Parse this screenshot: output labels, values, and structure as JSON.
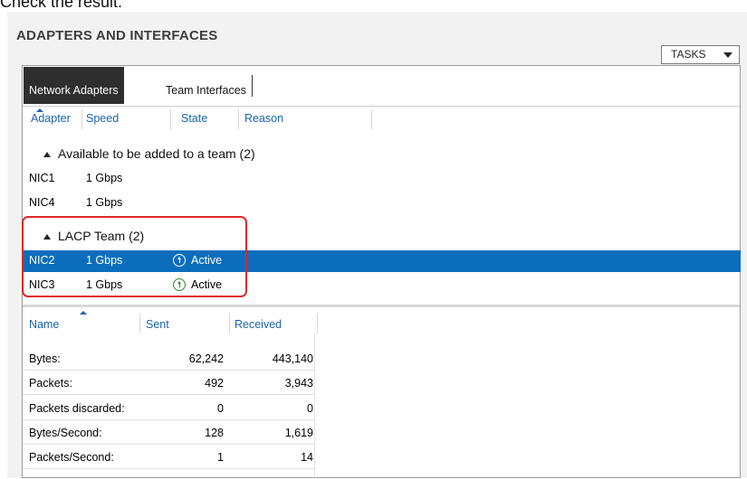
{
  "caption": "Check the result:",
  "section": {
    "title": "ADAPTERS AND INTERFACES",
    "tasks_label": "TASKS"
  },
  "tabs": [
    {
      "label": "Network Adapters",
      "active": true
    },
    {
      "label": "Team Interfaces",
      "active": false
    }
  ],
  "adapters": {
    "columns": [
      "Adapter",
      "Speed",
      "State",
      "Reason"
    ],
    "groups": [
      {
        "label": "Available to be added to a team (2)",
        "rows": [
          {
            "adapter": "NIC1",
            "speed": "1 Gbps",
            "state": "",
            "reason": ""
          },
          {
            "adapter": "NIC4",
            "speed": "1 Gbps",
            "state": "",
            "reason": ""
          }
        ]
      },
      {
        "label": "LACP Team (2)",
        "rows": [
          {
            "adapter": "NIC2",
            "speed": "1 Gbps",
            "state": "Active",
            "reason": "",
            "selected": true
          },
          {
            "adapter": "NIC3",
            "speed": "1 Gbps",
            "state": "Active",
            "reason": ""
          }
        ]
      }
    ]
  },
  "stats": {
    "columns": [
      "Name",
      "Sent",
      "Received"
    ],
    "rows": [
      {
        "name": "Bytes:",
        "sent": "62,242",
        "received": "443,140"
      },
      {
        "name": "Packets:",
        "sent": "492",
        "received": "3,943"
      },
      {
        "name": "Packets discarded:",
        "sent": "0",
        "received": "0"
      },
      {
        "name": "Bytes/Second:",
        "sent": "128",
        "received": "1,619"
      },
      {
        "name": "Packets/Second:",
        "sent": "1",
        "received": "14"
      }
    ]
  },
  "colors": {
    "selection": "#0a6ebd",
    "header_link": "#1a62b0",
    "highlight": "#e02828",
    "active_icon": "#2e8b2e"
  }
}
